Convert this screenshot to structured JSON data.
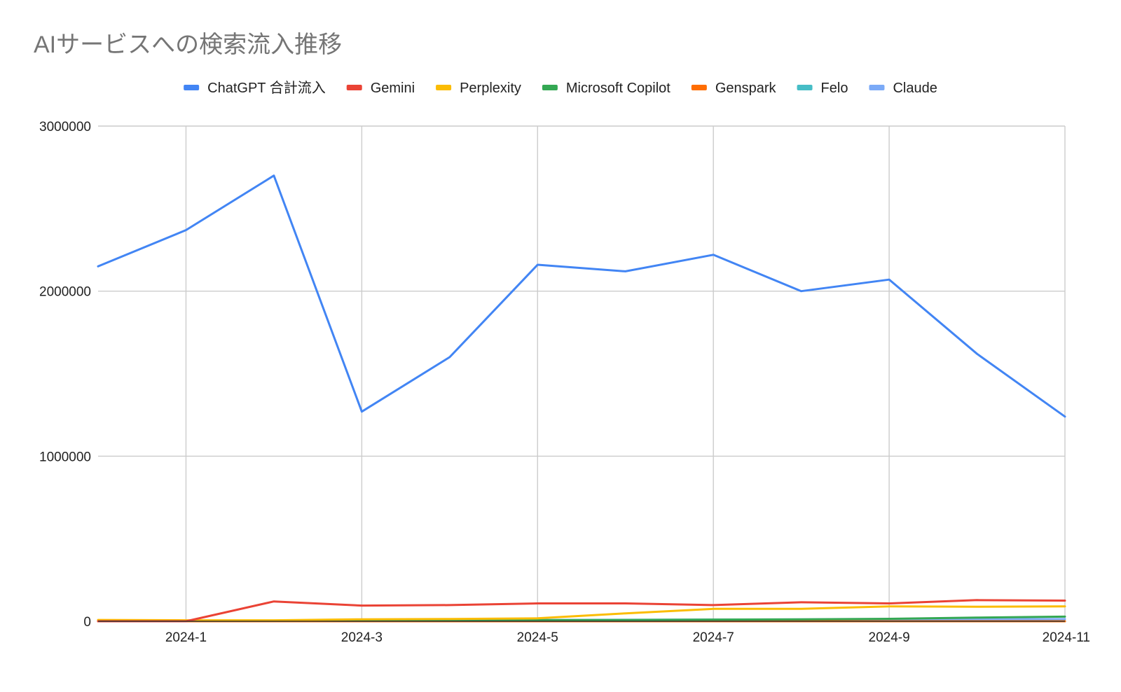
{
  "chart_data": {
    "type": "line",
    "title": "AIサービスへの検索流入推移",
    "xlabel": "",
    "ylabel": "",
    "x": [
      "2023-12",
      "2024-1",
      "2024-2",
      "2024-3",
      "2024-4",
      "2024-5",
      "2024-6",
      "2024-7",
      "2024-8",
      "2024-9",
      "2024-10",
      "2024-11"
    ],
    "x_tick_labels": [
      "2024-1",
      "2024-3",
      "2024-5",
      "2024-7",
      "2024-9",
      "2024-11"
    ],
    "y_tick_labels": [
      "0",
      "1000000",
      "2000000",
      "3000000"
    ],
    "y_ticks": [
      0,
      1000000,
      2000000,
      3000000
    ],
    "ylim": [
      0,
      3000000
    ],
    "grid": true,
    "legend_position": "top",
    "series": [
      {
        "name": "ChatGPT 合計流入",
        "color": "#4285f4",
        "values": [
          2150000,
          2370000,
          2700000,
          1270000,
          1600000,
          2160000,
          2120000,
          2220000,
          2000000,
          2070000,
          1620000,
          1240000
        ]
      },
      {
        "name": "Gemini",
        "color": "#ea4335",
        "values": [
          0,
          0,
          120000,
          95000,
          98000,
          108000,
          108000,
          98000,
          115000,
          108000,
          128000,
          125000
        ]
      },
      {
        "name": "Perplexity",
        "color": "#fbbc04",
        "values": [
          8000,
          6000,
          6000,
          12000,
          14000,
          18000,
          48000,
          75000,
          75000,
          90000,
          88000,
          90000
        ]
      },
      {
        "name": "Microsoft Copilot",
        "color": "#34a853",
        "values": [
          5000,
          4000,
          4000,
          5000,
          6000,
          7000,
          8000,
          10000,
          12000,
          15000,
          22000,
          28000
        ]
      },
      {
        "name": "Genspark",
        "color": "#ff6d01",
        "values": [
          0,
          0,
          0,
          0,
          0,
          0,
          0,
          0,
          0,
          0,
          0,
          0
        ]
      },
      {
        "name": "Felo",
        "color": "#46bdc6",
        "values": [
          0,
          0,
          0,
          0,
          0,
          0,
          0,
          0,
          0,
          0,
          0,
          0
        ]
      },
      {
        "name": "Claude",
        "color": "#7baaf7",
        "values": [
          2000,
          2000,
          3000,
          6000,
          7000,
          8000,
          9000,
          10000,
          11000,
          12000,
          12000,
          13000
        ]
      }
    ]
  }
}
